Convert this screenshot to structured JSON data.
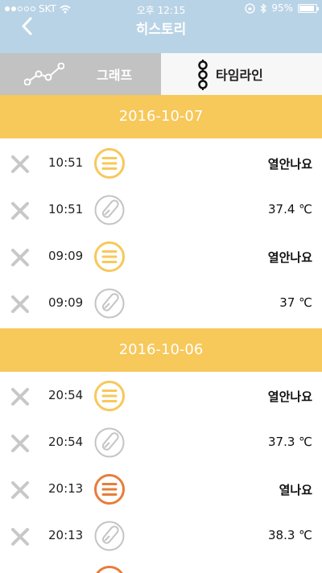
{
  "status_bar": {
    "carrier": "SKT",
    "time": "오후 12:15",
    "battery": "95%"
  },
  "nav": {
    "title": "히스토리"
  },
  "tabs": {
    "graph": "그래프",
    "timeline": "타임라인"
  },
  "colors": {
    "header_blue": "#b9d3e6",
    "date_yellow": "#f7c85a",
    "icon_yellow": "#f7c85a",
    "icon_orange": "#e87c39",
    "icon_gray": "#c4c4c4"
  },
  "sections": [
    {
      "date": "2016-10-07",
      "rows": [
        {
          "time": "10:51",
          "icon": "menu-icon",
          "value": "열안나요"
        },
        {
          "time": "10:51",
          "icon": "thermometer-icon",
          "value": "37.4 ℃"
        },
        {
          "time": "09:09",
          "icon": "menu-icon",
          "value": "열안나요"
        },
        {
          "time": "09:09",
          "icon": "thermometer-icon",
          "value": "37 ℃"
        }
      ]
    },
    {
      "date": "2016-10-06",
      "rows": [
        {
          "time": "20:54",
          "icon": "menu-icon",
          "value": "열안나요"
        },
        {
          "time": "20:54",
          "icon": "thermometer-icon",
          "value": "37.3 ℃"
        },
        {
          "time": "20:13",
          "icon": "menu-icon",
          "value": "열나요"
        },
        {
          "time": "20:13",
          "icon": "thermometer-icon",
          "value": "38.3 ℃"
        }
      ]
    }
  ]
}
